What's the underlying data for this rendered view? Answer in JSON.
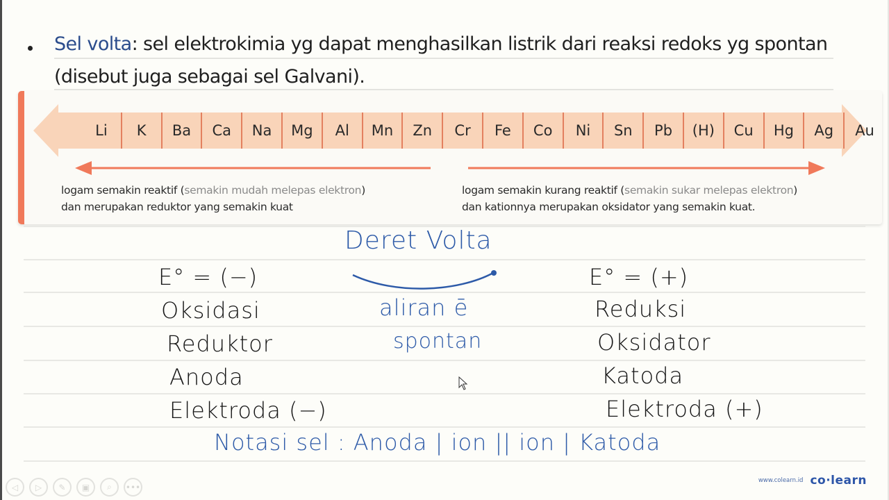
{
  "slide": {
    "bullet": {
      "term": "Sel volta",
      "definition": ": sel elektrokimia yg dapat menghasilkan listrik dari reaksi redoks yg spontan",
      "continuation": "(disebut juga sebagai sel Galvani)."
    },
    "volta_series": {
      "elements": [
        "Li",
        "K",
        "Ba",
        "Ca",
        "Na",
        "Mg",
        "Al",
        "Mn",
        "Zn",
        "Cr",
        "Fe",
        "Co",
        "Ni",
        "Sn",
        "Pb",
        "(H)",
        "Cu",
        "Hg",
        "Ag",
        "Au"
      ],
      "left_desc": {
        "line1_strong": "logam semakin reaktif (",
        "line1_muted": "semakin mudah melepas elektron",
        "line1_end": ")",
        "line2": "dan merupakan reduktor yang semakin kuat"
      },
      "right_desc": {
        "line1_strong": "logam semakin kurang reaktif (",
        "line1_muted": "semakin sukar melepas elektron",
        "line1_end": ")",
        "line2": "dan kationnya merupakan oksidator yang semakin kuat."
      }
    },
    "handwriting": {
      "title": "Deret Volta",
      "left_column": [
        "E° = (−)",
        "Oksidasi",
        "Reduktor",
        "Anoda",
        "Elektroda (−)"
      ],
      "center": {
        "flow": "aliran ē",
        "spontaneous": "spontan"
      },
      "right_column": [
        "E° = (+)",
        "Reduksi",
        "Oksidator",
        "Katoda",
        "Elektroda (+)"
      ],
      "notation": "Notasi sel : Anoda | ion || ion | Katoda"
    },
    "colors": {
      "accent_orange": "#f0795a",
      "series_fill": "#f9d4b9",
      "ink_blue": "#2d5aa8",
      "term_blue": "#2b4c8c"
    }
  },
  "toolbar": {
    "buttons": [
      {
        "name": "previous",
        "glyph": "◁"
      },
      {
        "name": "next",
        "glyph": "▷"
      },
      {
        "name": "pen",
        "glyph": "✎"
      },
      {
        "name": "slides",
        "glyph": "▣"
      },
      {
        "name": "zoom",
        "glyph": "⌕"
      },
      {
        "name": "more",
        "glyph": "•••"
      }
    ]
  },
  "brand": {
    "url": "www.colearn.id",
    "logo": "co·learn"
  }
}
